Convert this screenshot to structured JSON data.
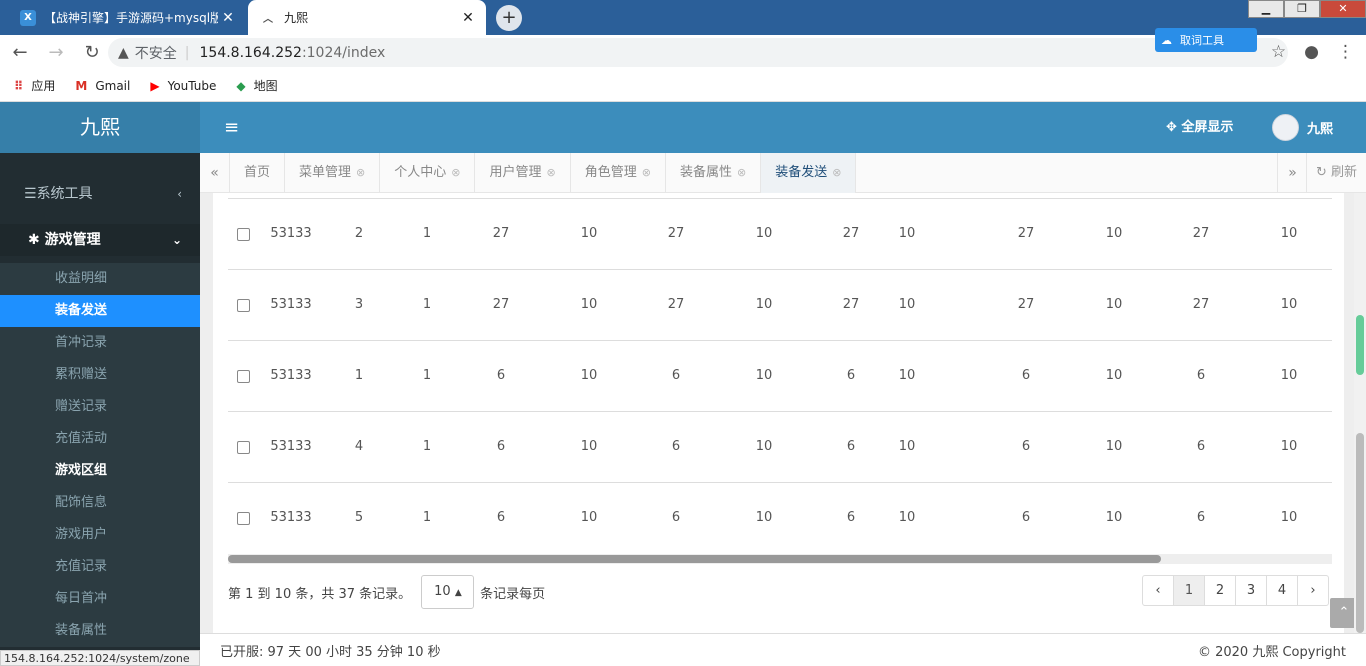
{
  "browser": {
    "tabs": [
      {
        "title": "【战神引擎】手游源码+mysql版"
      },
      {
        "title": "九熙"
      }
    ],
    "address": {
      "insecure_label": "不安全",
      "host": "154.8.164.252",
      "path": ":1024/index"
    },
    "extension_label": "取词工具",
    "bookmarks": [
      {
        "label": "应用"
      },
      {
        "label": "Gmail"
      },
      {
        "label": "YouTube"
      },
      {
        "label": "地图"
      }
    ],
    "status_url": "154.8.164.252:1024/system/zone"
  },
  "app": {
    "logo": "九熙",
    "fullscreen_label": "全屏显示",
    "user_name": "九熙"
  },
  "sidebar": {
    "section_tools": "系统工具",
    "section_game": "游戏管理",
    "items": [
      {
        "label": "收益明细"
      },
      {
        "label": "装备发送"
      },
      {
        "label": "首冲记录"
      },
      {
        "label": "累积赠送"
      },
      {
        "label": "赠送记录"
      },
      {
        "label": "充值活动"
      },
      {
        "label": "游戏区组"
      },
      {
        "label": "配饰信息"
      },
      {
        "label": "游戏用户"
      },
      {
        "label": "充值记录"
      },
      {
        "label": "每日首冲"
      },
      {
        "label": "装备属性"
      }
    ]
  },
  "page_tabs": [
    {
      "label": "首页"
    },
    {
      "label": "菜单管理"
    },
    {
      "label": "个人中心"
    },
    {
      "label": "用户管理"
    },
    {
      "label": "角色管理"
    },
    {
      "label": "装备属性"
    },
    {
      "label": "装备发送"
    }
  ],
  "refresh_label": "刷新",
  "table": {
    "rows": [
      [
        "53133",
        "2",
        "1",
        "27",
        "10",
        "27",
        "10",
        "27",
        "10",
        "27",
        "10",
        "27",
        "10"
      ],
      [
        "53133",
        "3",
        "1",
        "27",
        "10",
        "27",
        "10",
        "27",
        "10",
        "27",
        "10",
        "27",
        "10"
      ],
      [
        "53133",
        "1",
        "1",
        "6",
        "10",
        "6",
        "10",
        "6",
        "10",
        "6",
        "10",
        "6",
        "10"
      ],
      [
        "53133",
        "4",
        "1",
        "6",
        "10",
        "6",
        "10",
        "6",
        "10",
        "6",
        "10",
        "6",
        "10"
      ],
      [
        "53133",
        "5",
        "1",
        "6",
        "10",
        "6",
        "10",
        "6",
        "10",
        "6",
        "10",
        "6",
        "10"
      ]
    ]
  },
  "pagination": {
    "info": "第 1 到 10 条，共 37 条记录。",
    "page_size": "10",
    "per_page_label": "条记录每页",
    "prev": "‹",
    "pages": [
      "1",
      "2",
      "3",
      "4"
    ],
    "next": "›"
  },
  "footer": {
    "uptime": "已开服: 97 天 00 小时 35 分钟 10 秒",
    "copyright": "© 2020 九熙 Copyright"
  }
}
